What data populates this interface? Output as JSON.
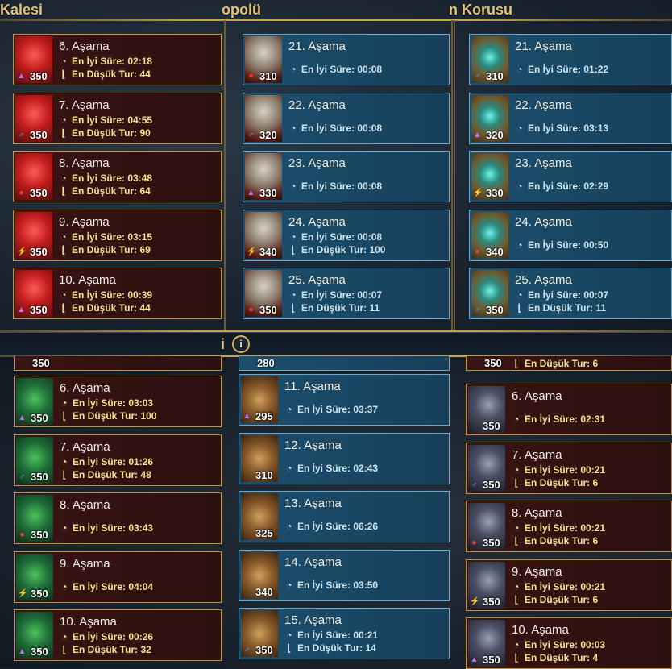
{
  "columns": {
    "left_title": "Kalesi",
    "middle_title": "opolü",
    "right_title": "n Korusu",
    "info_letter": "i",
    "info_symbol": "i"
  },
  "labels": {
    "best_time_prefix": "En İyi Süre: ",
    "min_turn_prefix": "En Düşük Tur: "
  },
  "top_left": [
    {
      "stage": "6. Aşama",
      "level": "350",
      "affinity": "magic",
      "best": "En İyi Süre: 02:18",
      "turn": "En Düşük Tur: 44"
    },
    {
      "stage": "7. Aşama",
      "level": "350",
      "affinity": "magic-blue",
      "best": "En İyi Süre: 04:55",
      "turn": "En Düşük Tur: 90"
    },
    {
      "stage": "8. Aşama",
      "level": "350",
      "affinity": "force",
      "best": "En İyi Süre: 03:48",
      "turn": "En Düşük Tur: 64"
    },
    {
      "stage": "9. Aşama",
      "level": "350",
      "affinity": "void",
      "best": "En İyi Süre: 03:15",
      "turn": "En Düşük Tur: 69"
    },
    {
      "stage": "10. Aşama",
      "level": "350",
      "affinity": "magic",
      "best": "En İyi Süre: 00:39",
      "turn": "En Düşük Tur: 44"
    }
  ],
  "top_middle": [
    {
      "stage": "21. Aşama",
      "level": "310",
      "affinity": "force",
      "best": "En İyi Süre: 00:08",
      "turn": ""
    },
    {
      "stage": "22. Aşama",
      "level": "320",
      "affinity": "magic-blue",
      "best": "En İyi Süre: 00:08",
      "turn": ""
    },
    {
      "stage": "23. Aşama",
      "level": "330",
      "affinity": "magic",
      "best": "En İyi Süre: 00:08",
      "turn": ""
    },
    {
      "stage": "24. Aşama",
      "level": "340",
      "affinity": "void",
      "best": "En İyi Süre: 00:08",
      "turn": "En Düşük Tur: 100"
    },
    {
      "stage": "25. Aşama",
      "level": "350",
      "affinity": "force",
      "best": "En İyi Süre: 00:07",
      "turn": "En Düşük Tur: 11"
    }
  ],
  "top_right": [
    {
      "stage": "21. Aşama",
      "level": "310",
      "affinity": "magic-blue",
      "best": "En İyi Süre: 01:22",
      "turn": ""
    },
    {
      "stage": "22. Aşama",
      "level": "320",
      "affinity": "magic",
      "best": "En İyi Süre: 03:13",
      "turn": ""
    },
    {
      "stage": "23. Aşama",
      "level": "330",
      "affinity": "void",
      "best": "En İyi Süre: 02:29",
      "turn": ""
    },
    {
      "stage": "24. Aşama",
      "level": "340",
      "affinity": "force",
      "best": "En İyi Süre: 00:50",
      "turn": ""
    },
    {
      "stage": "25. Aşama",
      "level": "350",
      "affinity": "magic-blue",
      "best": "En İyi Süre: 00:07",
      "turn": "En Düşük Tur: 11"
    }
  ],
  "bottom_left_partial": {
    "level": "350"
  },
  "bottom_left": [
    {
      "stage": "6. Aşama",
      "level": "350",
      "affinity": "magic",
      "best": "En İyi Süre: 03:03",
      "turn": "En Düşük Tur: 100"
    },
    {
      "stage": "7. Aşama",
      "level": "350",
      "affinity": "magic-blue",
      "best": "En İyi Süre: 01:26",
      "turn": "En Düşük Tur: 48"
    },
    {
      "stage": "8. Aşama",
      "level": "350",
      "affinity": "force",
      "best": "En İyi Süre: 03:43",
      "turn": ""
    },
    {
      "stage": "9. Aşama",
      "level": "350",
      "affinity": "void",
      "best": "En İyi Süre: 04:04",
      "turn": ""
    },
    {
      "stage": "10. Aşama",
      "level": "350",
      "affinity": "magic",
      "best": "En İyi Süre: 00:26",
      "turn": "En Düşük Tur: 32"
    }
  ],
  "bottom_middle_partial": {
    "level": "280"
  },
  "bottom_middle": [
    {
      "stage": "11. Aşama",
      "level": "295",
      "affinity": "magic",
      "best": "En İyi Süre: 03:37",
      "turn": ""
    },
    {
      "stage": "12. Aşama",
      "level": "310",
      "affinity": "none",
      "best": "En İyi Süre: 02:43",
      "turn": ""
    },
    {
      "stage": "13. Aşama",
      "level": "325",
      "affinity": "none",
      "best": "En İyi Süre: 06:26",
      "turn": ""
    },
    {
      "stage": "14. Aşama",
      "level": "340",
      "affinity": "none",
      "best": "En İyi Süre: 03:50",
      "turn": ""
    },
    {
      "stage": "15. Aşama",
      "level": "350",
      "affinity": "magic-blue",
      "best": "En İyi Süre: 00:21",
      "turn": "En Düşük Tur: 14"
    }
  ],
  "bottom_right_partial": {
    "level": "350",
    "turn": "En Düşük Tur: 6"
  },
  "bottom_right": [
    {
      "stage": "6. Aşama",
      "level": "350",
      "affinity": "none",
      "best": "En İyi Süre: 02:31",
      "turn": ""
    },
    {
      "stage": "7. Aşama",
      "level": "350",
      "affinity": "magic-blue",
      "best": "En İyi Süre: 00:21",
      "turn": "En Düşük Tur: 6"
    },
    {
      "stage": "8. Aşama",
      "level": "350",
      "affinity": "force",
      "best": "En İyi Süre: 00:21",
      "turn": "En Düşük Tur: 6"
    },
    {
      "stage": "9. Aşama",
      "level": "350",
      "affinity": "void",
      "best": "En İyi Süre: 00:21",
      "turn": "En Düşük Tur: 6"
    },
    {
      "stage": "10. Aşama",
      "level": "350",
      "affinity": "magic",
      "best": "En İyi Süre: 00:03",
      "turn": "En Düşük Tur: 4"
    }
  ],
  "colors": {
    "gold": "#c9a24a",
    "red_card": "#3a1414",
    "blue_card": "#1c4f6e",
    "yellow_text": "#f3e48d",
    "selected_border": "#4fc3ff"
  }
}
